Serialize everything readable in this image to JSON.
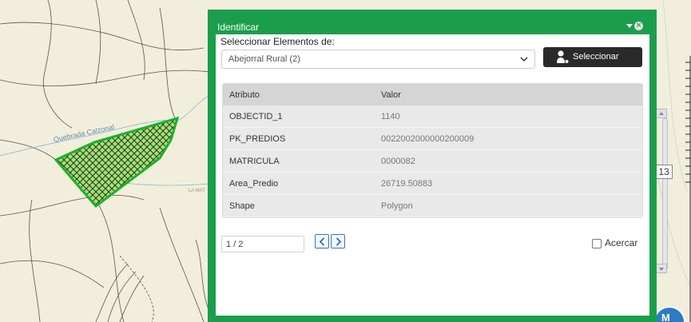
{
  "map": {
    "stream_label": "Quebrada Calzonal",
    "place_label": "LA MAT",
    "zoom_level": "13",
    "badge_text": "M"
  },
  "panel": {
    "title": "Identificar",
    "select_label": "Seleccionar Elementos de:",
    "layer_value": "Abejorral Rural (2)",
    "select_button": "Seleccionar",
    "columns": {
      "attribute": "Atributo",
      "value": "Valor"
    },
    "rows": [
      {
        "attribute": "OBJECTID_1",
        "value": "1140"
      },
      {
        "attribute": "PK_PREDIOS",
        "value": "0022002000000200009"
      },
      {
        "attribute": "MATRICULA",
        "value": "0000082"
      },
      {
        "attribute": "Area_Predio",
        "value": "26719.50883"
      },
      {
        "attribute": "Shape",
        "value": "Polygon"
      }
    ],
    "page_indicator": "1 / 2",
    "zoom_checkbox_label": "Acercar",
    "zoom_checked": false
  },
  "colors": {
    "panel_green": "#1b9e4b",
    "polygon_fill": "#a6e07a",
    "button_dark": "#2a2a2a"
  }
}
